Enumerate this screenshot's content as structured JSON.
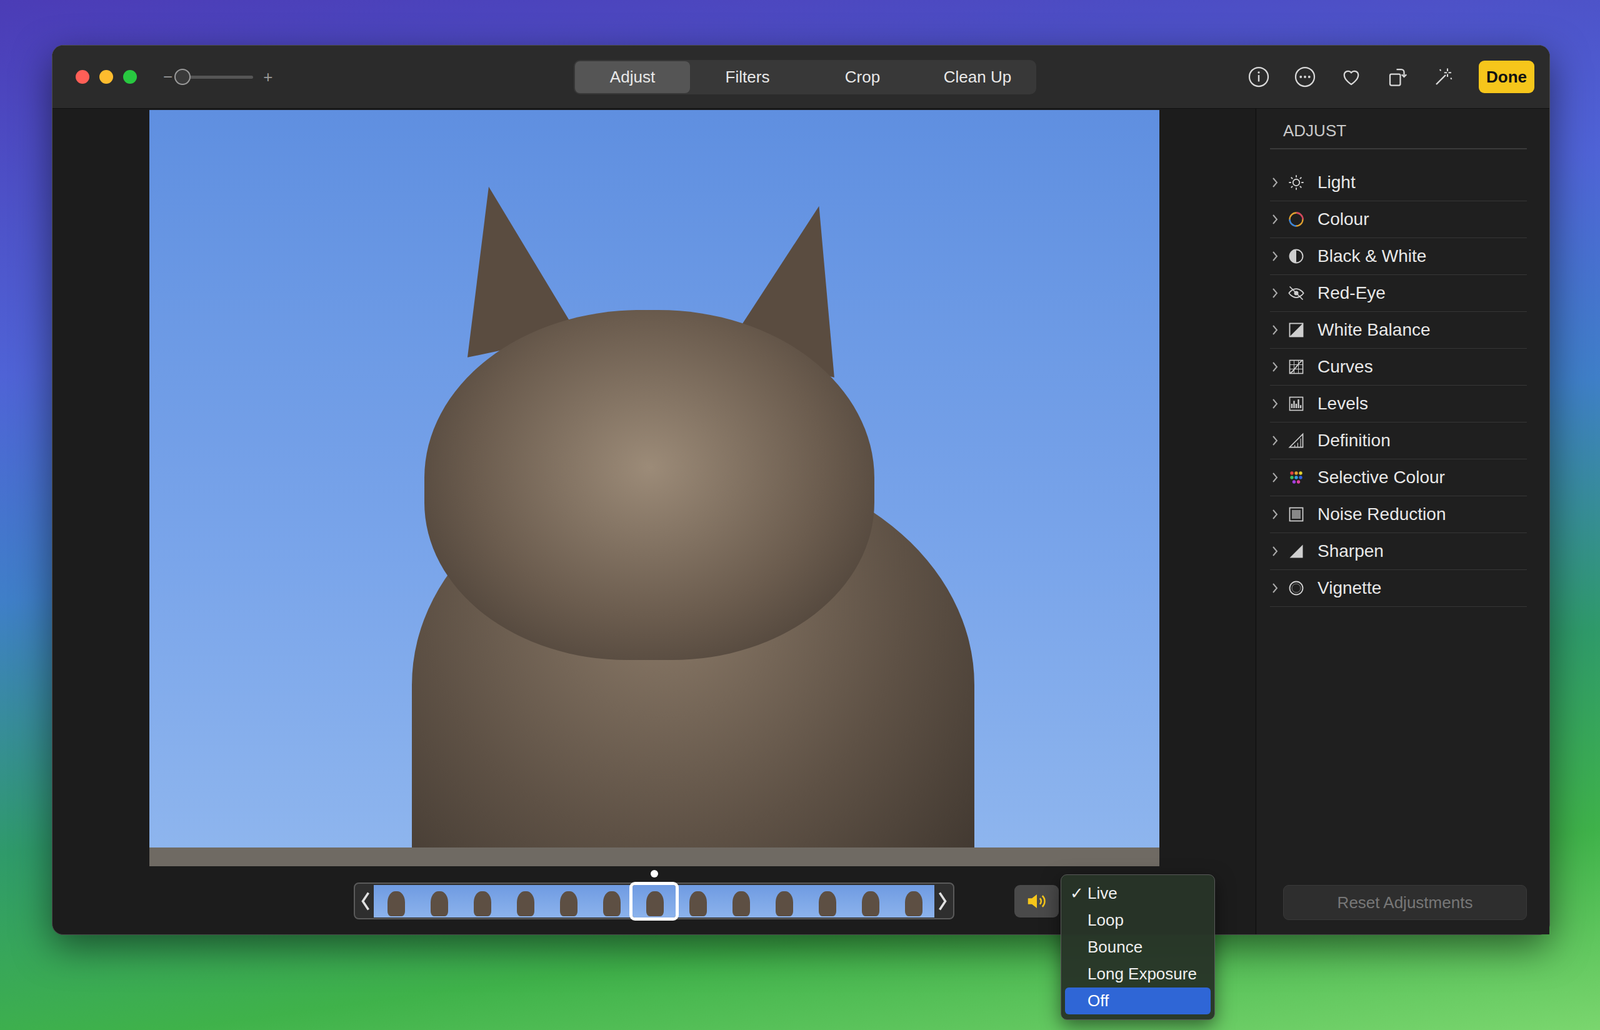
{
  "window": {
    "controls": [
      {
        "name": "close",
        "color": "#ff5f57"
      },
      {
        "name": "minimize",
        "color": "#febc2e"
      },
      {
        "name": "zoom",
        "color": "#28c840"
      }
    ]
  },
  "zoom": {
    "minus": "−",
    "plus": "+",
    "level": 0
  },
  "tabs": [
    {
      "label": "Adjust",
      "selected": true
    },
    {
      "label": "Filters",
      "selected": false
    },
    {
      "label": "Crop",
      "selected": false
    },
    {
      "label": "Clean Up",
      "selected": false
    }
  ],
  "toolbar": {
    "done": "Done",
    "favorite": false
  },
  "filmstrip": {
    "frames": [
      {
        "selected": false
      },
      {
        "selected": false
      },
      {
        "selected": false
      },
      {
        "selected": false
      },
      {
        "selected": false
      },
      {
        "selected": false
      },
      {
        "selected": true
      },
      {
        "selected": false
      },
      {
        "selected": false
      },
      {
        "selected": false
      },
      {
        "selected": false
      },
      {
        "selected": false
      },
      {
        "selected": false
      }
    ]
  },
  "sound": {
    "on": true
  },
  "playback_menu": {
    "check": "✓",
    "items": [
      {
        "label": "Live",
        "checked": true,
        "highlighted": false
      },
      {
        "label": "Loop",
        "checked": false,
        "highlighted": false
      },
      {
        "label": "Bounce",
        "checked": false,
        "highlighted": false
      },
      {
        "label": "Long Exposure",
        "checked": false,
        "highlighted": false
      },
      {
        "label": "Off",
        "checked": false,
        "highlighted": true
      }
    ]
  },
  "sidebar": {
    "title": "ADJUST",
    "items": [
      {
        "label": "Light",
        "expanded": false
      },
      {
        "label": "Colour",
        "expanded": false
      },
      {
        "label": "Black & White",
        "expanded": false
      },
      {
        "label": "Red-Eye",
        "expanded": false
      },
      {
        "label": "White Balance",
        "expanded": false
      },
      {
        "label": "Curves",
        "expanded": false
      },
      {
        "label": "Levels",
        "expanded": false
      },
      {
        "label": "Definition",
        "expanded": false
      },
      {
        "label": "Selective Colour",
        "expanded": false
      },
      {
        "label": "Noise Reduction",
        "expanded": false
      },
      {
        "label": "Sharpen",
        "expanded": false
      },
      {
        "label": "Vignette",
        "expanded": false
      }
    ],
    "reset": {
      "label": "Reset Adjustments",
      "disabled": true
    }
  }
}
